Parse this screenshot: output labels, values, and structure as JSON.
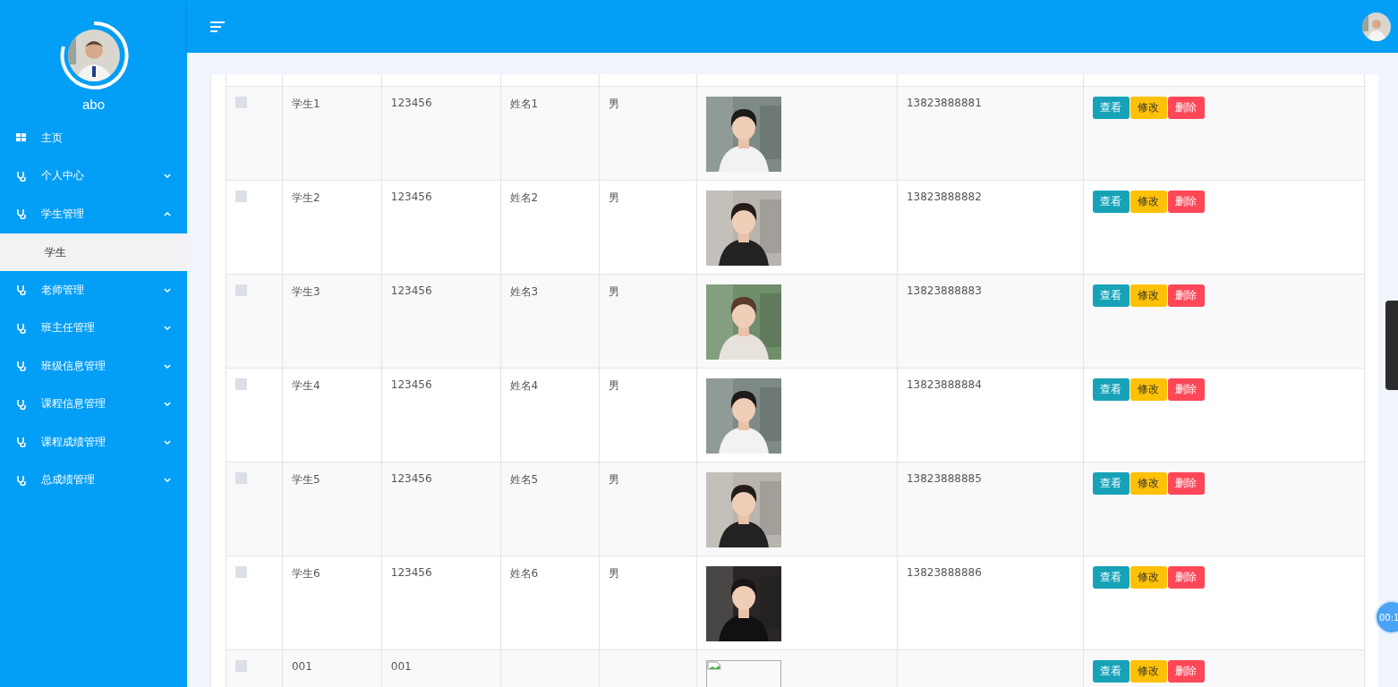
{
  "sidebar": {
    "user_name": "abo",
    "items": [
      {
        "label": "主页",
        "kind": "home"
      },
      {
        "label": "个人中心",
        "kind": "group",
        "expanded": false
      },
      {
        "label": "学生管理",
        "kind": "group",
        "expanded": true,
        "children": [
          {
            "label": "学生",
            "selected": true
          }
        ]
      },
      {
        "label": "老师管理",
        "kind": "group",
        "expanded": false
      },
      {
        "label": "班主任管理",
        "kind": "group",
        "expanded": false
      },
      {
        "label": "班级信息管理",
        "kind": "group",
        "expanded": false
      },
      {
        "label": "课程信息管理",
        "kind": "group",
        "expanded": false
      },
      {
        "label": "课程成绩管理",
        "kind": "group",
        "expanded": false
      },
      {
        "label": "总成绩管理",
        "kind": "group",
        "expanded": false
      }
    ]
  },
  "table": {
    "rows": [
      {
        "checked": false,
        "account": "学生1",
        "password": "123456",
        "name": "姓名1",
        "gender": "男",
        "phone": "13823888881",
        "actions": [
          "查看",
          "修改",
          "删除"
        ]
      },
      {
        "checked": false,
        "account": "学生2",
        "password": "123456",
        "name": "姓名2",
        "gender": "男",
        "phone": "13823888882",
        "actions": [
          "查看",
          "修改",
          "删除"
        ]
      },
      {
        "checked": false,
        "account": "学生3",
        "password": "123456",
        "name": "姓名3",
        "gender": "男",
        "phone": "13823888883",
        "actions": [
          "查看",
          "修改",
          "删除"
        ]
      },
      {
        "checked": false,
        "account": "学生4",
        "password": "123456",
        "name": "姓名4",
        "gender": "男",
        "phone": "13823888884",
        "actions": [
          "查看",
          "修改",
          "删除"
        ]
      },
      {
        "checked": false,
        "account": "学生5",
        "password": "123456",
        "name": "姓名5",
        "gender": "男",
        "phone": "13823888885",
        "actions": [
          "查看",
          "修改",
          "删除"
        ]
      },
      {
        "checked": false,
        "account": "学生6",
        "password": "123456",
        "name": "姓名6",
        "gender": "男",
        "phone": "13823888886",
        "actions": [
          "查看",
          "修改",
          "删除"
        ]
      },
      {
        "checked": false,
        "account": "001",
        "password": "001",
        "photo": {
          "kind": "broken"
        },
        "actions": [
          "查看",
          "修改",
          "删除"
        ]
      }
    ]
  },
  "recorder_timer": "00:1"
}
